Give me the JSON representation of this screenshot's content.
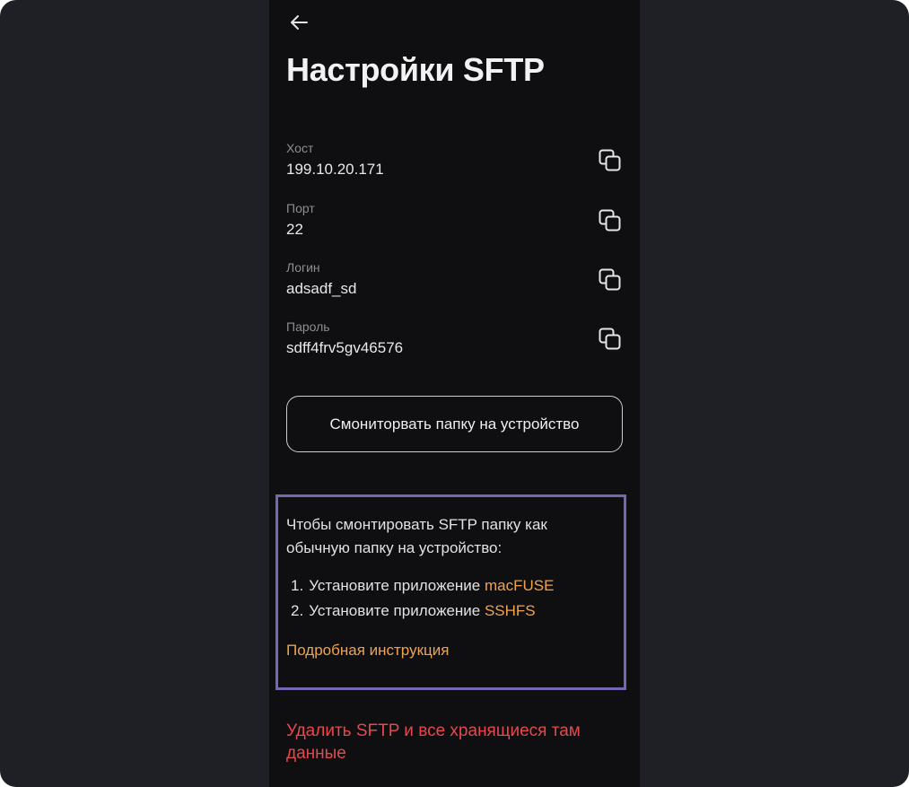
{
  "page": {
    "title": "Настройки SFTP"
  },
  "fields": [
    {
      "label": "Хост",
      "value": "199.10.20.171"
    },
    {
      "label": "Порт",
      "value": "22"
    },
    {
      "label": "Логин",
      "value": "adsadf_sd"
    },
    {
      "label": "Пароль",
      "value": "sdff4frv5gv46576"
    }
  ],
  "mount_button": {
    "label": "Смониторвать папку на устройство"
  },
  "info": {
    "intro": "Чтобы смонтировать SFTP папку как обычную папку на устройство:",
    "steps": [
      {
        "num": "1.",
        "text": "Установите приложение ",
        "link": "macFUSE"
      },
      {
        "num": "2.",
        "text": "Установите приложение ",
        "link": "SSHFS"
      }
    ],
    "guide_link": "Подробная инструкция"
  },
  "delete_link": "Удалить SFTP и все хранящиеся там данные",
  "icons": {
    "back": "arrow-left-icon",
    "copy": "copy-icon"
  },
  "colors": {
    "background": "#1f2025",
    "panel": "#0f0f11",
    "accent_link": "#f0a34f",
    "danger": "#e5484d",
    "highlight_border": "#7667b3"
  }
}
